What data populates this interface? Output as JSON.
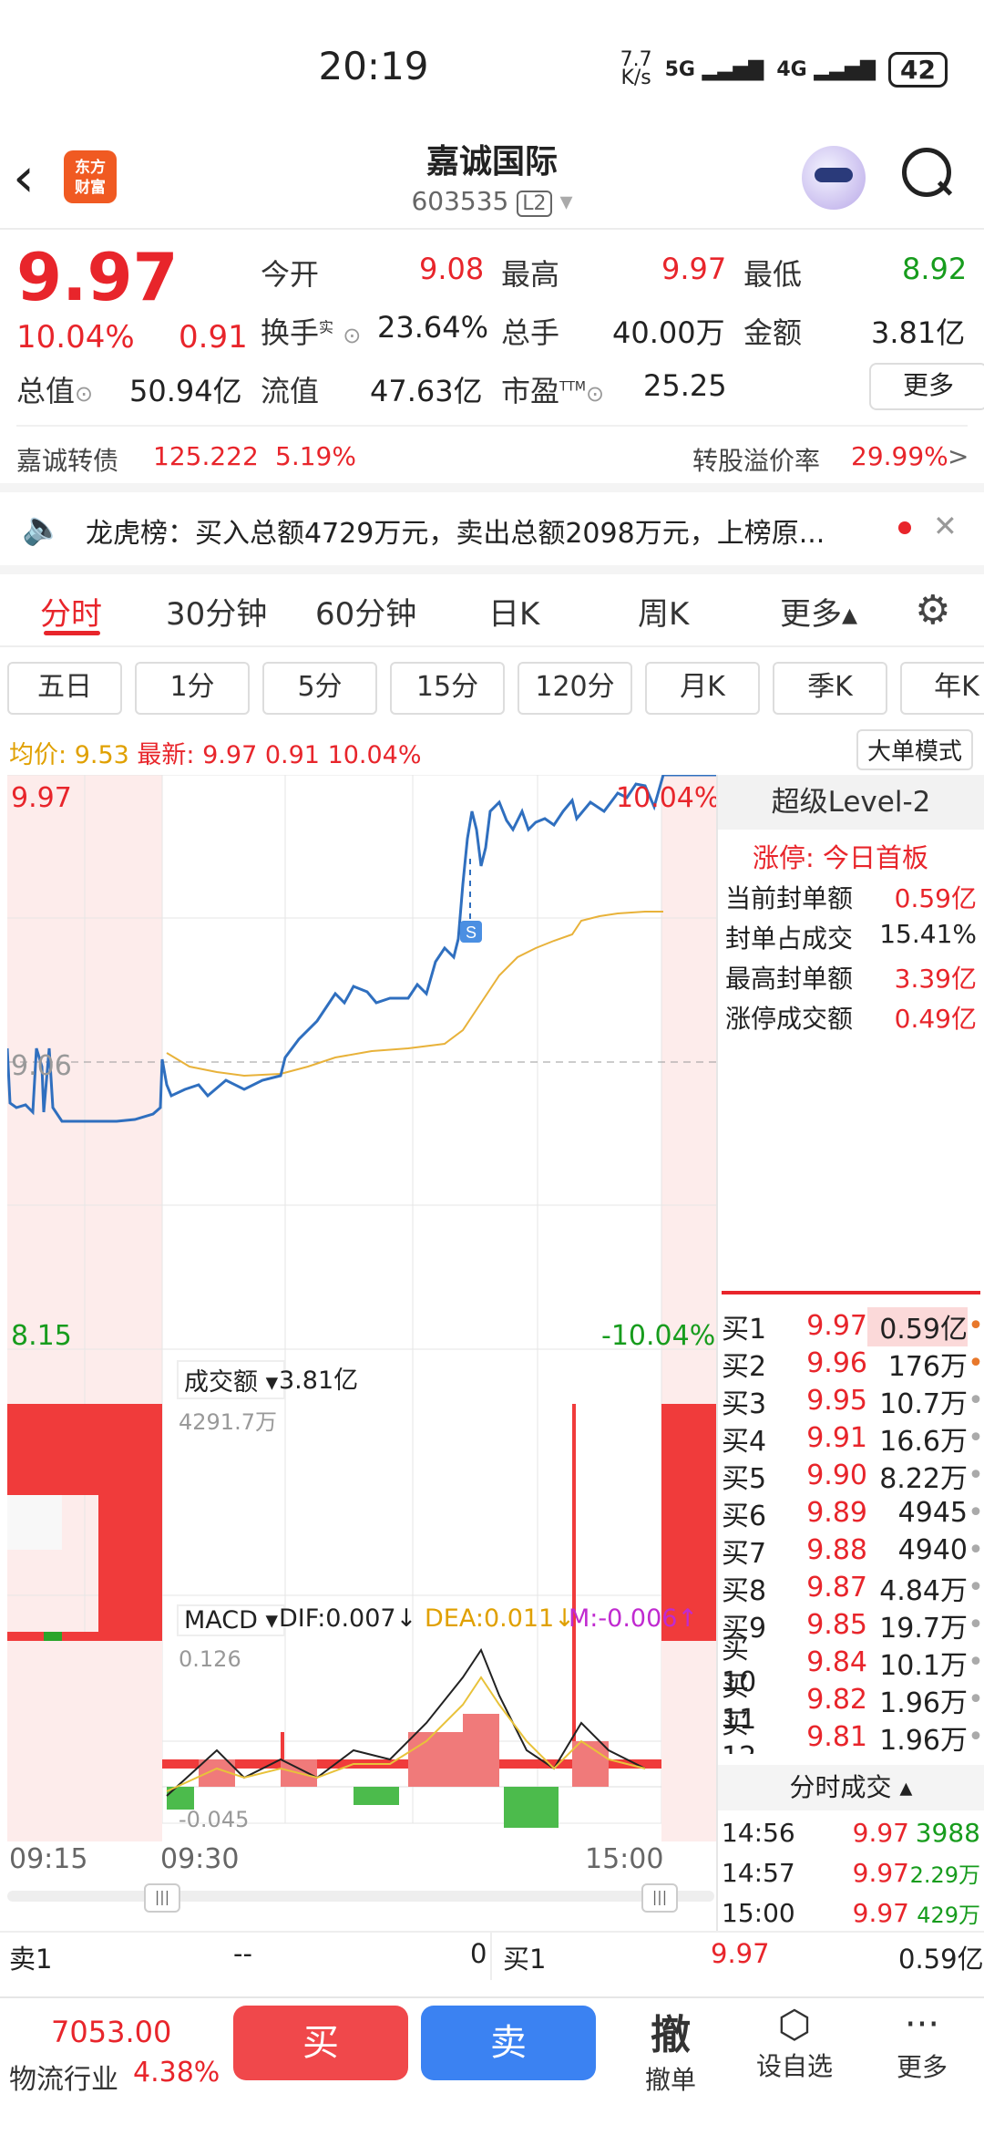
{
  "status_bar": {
    "time": "20:19",
    "net_speed_value": "7.7",
    "net_speed_unit": "K/s",
    "sig1": "5G",
    "sig2": "4G",
    "battery": "42"
  },
  "header": {
    "title": "嘉诚国际",
    "code": "603535",
    "badge": "L2",
    "logo_text_1": "东方",
    "logo_text_2": "财富"
  },
  "quote": {
    "price": "9.97",
    "change_pct": "10.04%",
    "change": "0.91",
    "open_label": "今开",
    "open": "9.08",
    "high_label": "最高",
    "high": "9.97",
    "low_label": "最低",
    "low": "8.92",
    "turnover_label": "换手",
    "turnover_sup": "实",
    "turnover": "23.64%",
    "volume_label": "总手",
    "volume": "40.00万",
    "amount_label": "金额",
    "amount": "3.81亿",
    "mktcap_label": "总值",
    "mktcap": "50.94亿",
    "float_label": "流值",
    "float": "47.63亿",
    "pe_label": "市盈",
    "pe_sup": "TTM",
    "pe": "25.25",
    "more_label": "更多"
  },
  "bond": {
    "name": "嘉诚转债",
    "price": "125.222",
    "pct": "5.19%",
    "premium_label": "转股溢价率",
    "premium": "29.99%",
    "arrow": ">"
  },
  "notice": {
    "text": "龙虎榜：买入总额4729万元，卖出总额2098万元，上榜原...",
    "close": "✕"
  },
  "tabs": [
    "分时",
    "30分钟",
    "60分钟",
    "日K",
    "周K",
    "更多▴"
  ],
  "sub_tabs": [
    "五日",
    "1分",
    "5分",
    "15分",
    "120分",
    "月K",
    "季K",
    "年K"
  ],
  "info_line": {
    "avg_label": "均价:",
    "avg": "9.53",
    "latest_label": "最新:",
    "latest": "9.97",
    "chg": "0.91",
    "pct": "10.04%",
    "big_order": "大单模式"
  },
  "chart_labels": {
    "top_price": "9.97",
    "top_pct": "10.04%",
    "mid_price": "9.06",
    "bottom_price": "8.15",
    "bottom_pct": "-10.04%",
    "volume_label": "成交额",
    "volume_total": "3.81亿",
    "volume_max": "4291.7万",
    "macd_label": "MACD",
    "dif": "DIF:0.007↓",
    "dea": "DEA:0.011↓",
    "m": "M:-0.006↑",
    "macd_max": "0.126",
    "macd_min": "-0.045",
    "time_start": "09:15",
    "time_open": "09:30",
    "time_end": "15:00"
  },
  "l2_panel": {
    "title": "超级Level-2",
    "limit_label": "涨停:",
    "limit_text": "今日首板",
    "rows": [
      {
        "label": "当前封单额",
        "value": "0.59亿"
      },
      {
        "label": "封单占成交",
        "value": "15.41%"
      },
      {
        "label": "最高封单额",
        "value": "3.39亿"
      },
      {
        "label": "涨停成交额",
        "value": "0.49亿"
      }
    ],
    "bids": [
      {
        "label": "买1",
        "price": "9.97",
        "vol": "0.59亿",
        "dot": "•"
      },
      {
        "label": "买2",
        "price": "9.96",
        "vol": "176万",
        "dot": "•"
      },
      {
        "label": "买3",
        "price": "9.95",
        "vol": "10.7万",
        "dot": "•"
      },
      {
        "label": "买4",
        "price": "9.91",
        "vol": "16.6万",
        "dot": "•"
      },
      {
        "label": "买5",
        "price": "9.90",
        "vol": "8.22万",
        "dot": "•"
      },
      {
        "label": "买6",
        "price": "9.89",
        "vol": "4945",
        "dot": "•"
      },
      {
        "label": "买7",
        "price": "9.88",
        "vol": "4940",
        "dot": "•"
      },
      {
        "label": "买8",
        "price": "9.87",
        "vol": "4.84万",
        "dot": "•"
      },
      {
        "label": "买9",
        "price": "9.85",
        "vol": "19.7万",
        "dot": "•"
      },
      {
        "label": "买10",
        "price": "9.84",
        "vol": "10.1万",
        "dot": "•"
      },
      {
        "label": "买11",
        "price": "9.82",
        "vol": "1.96万",
        "dot": "•"
      },
      {
        "label": "买12",
        "price": "9.81",
        "vol": "1.96万",
        "dot": "•"
      }
    ],
    "trades_title": "分时成交 ▴",
    "trades": [
      {
        "time": "14:56",
        "price": "9.97",
        "vol": "3988"
      },
      {
        "time": "14:57",
        "price": "9.97",
        "vol": "2.29万"
      },
      {
        "time": "15:00",
        "price": "9.97",
        "vol": "429万"
      }
    ]
  },
  "book_line": {
    "sell_label": "卖1",
    "sell_price": "--",
    "sell_vol": "0",
    "buy_label": "买1",
    "buy_price": "9.97",
    "buy_vol": "0.59亿"
  },
  "bottom": {
    "index_value": "7053.00",
    "index_name": "物流行业",
    "index_pct": "4.38%",
    "buy": "买",
    "sell": "卖",
    "cancel_icon": "撤",
    "cancel": "撤单",
    "watch": "设自选",
    "more": "更多"
  }
}
